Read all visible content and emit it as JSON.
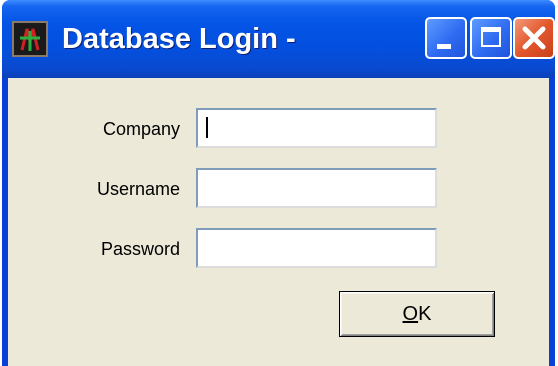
{
  "window": {
    "title": "Database Login -",
    "app_icon": "app-icon",
    "controls": {
      "minimize": "minimize-icon",
      "maximize": "maximize-icon",
      "close": "close-icon"
    }
  },
  "form": {
    "company_label": "Company",
    "company_value": "",
    "username_label": "Username",
    "username_value": "",
    "password_label": "Password",
    "password_value": ""
  },
  "ok_button": {
    "mnemonic": "O",
    "rest": "K"
  },
  "colors": {
    "titlebar": "#0454e6",
    "client": "#ece9d8",
    "close": "#e3572c"
  }
}
